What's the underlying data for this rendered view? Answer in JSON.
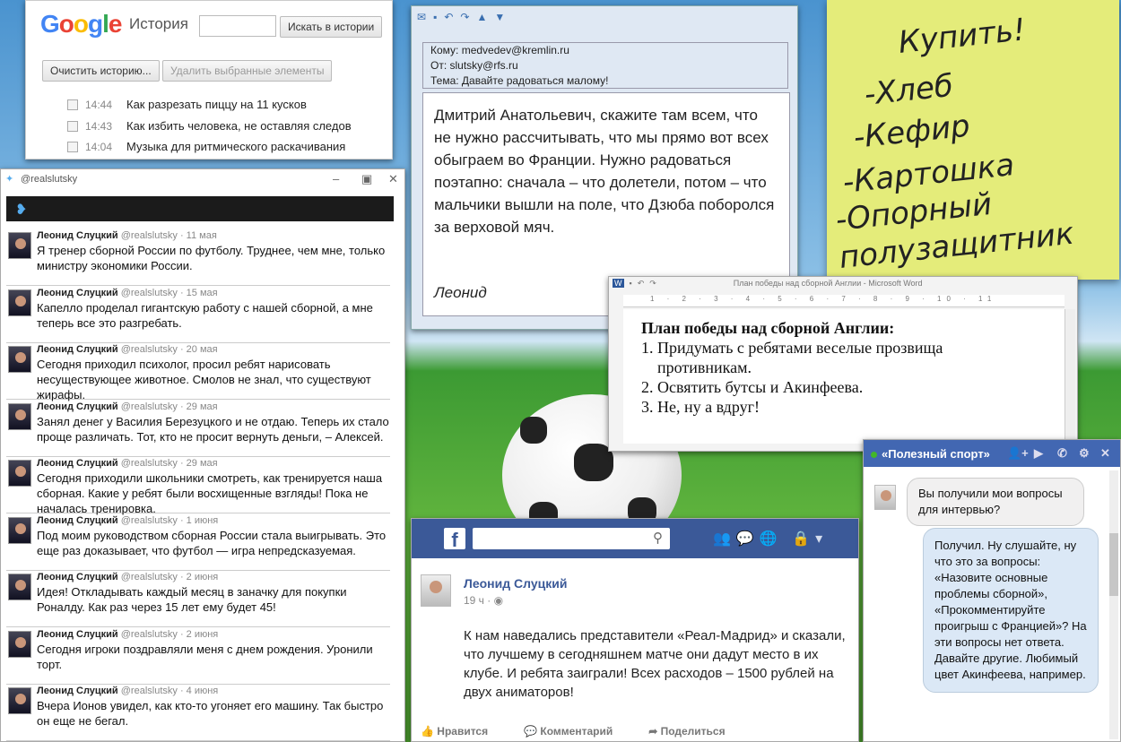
{
  "colors": {
    "google_blue": "#4285f4",
    "google_red": "#ea4335",
    "google_yellow": "#fbbc05",
    "google_green": "#34a853",
    "facebook_blue": "#3b5998",
    "messenger_blue": "#4267b2",
    "sticky_yellow": "#e4ec7a",
    "twitter_blue": "#55acee"
  },
  "google": {
    "logo": "Google",
    "title": "История",
    "search_button": "Искать в истории",
    "clear_button": "Очистить историю...",
    "delete_button": "Удалить выбранные элементы",
    "items": [
      {
        "time": "14:44",
        "text": "Как разрезать пиццу на 11 кусков"
      },
      {
        "time": "14:43",
        "text": "Как избить человека, не оставляя следов"
      },
      {
        "time": "14:04",
        "text": "Музыка для ритмического раскачивания"
      }
    ]
  },
  "twitter": {
    "window_title": "@realslutsky",
    "tweets": [
      {
        "name": "Леонид Слуцкий",
        "handle": "@realslutsky · 11 мая",
        "text": "Я тренер сборной России по футболу. Труднее, чем мне, только министру экономики России."
      },
      {
        "name": "Леонид Слуцкий",
        "handle": "@realslutsky · 15 мая",
        "text": "Капелло проделал гигантскую работу с нашей сборной, а мне теперь все это разгребать."
      },
      {
        "name": "Леонид Слуцкий",
        "handle": "@realslutsky · 20 мая",
        "text": "Сегодня приходил психолог, просил ребят нарисовать несуществующее животное. Смолов не знал, что существуют жирафы."
      },
      {
        "name": "Леонид Слуцкий",
        "handle": "@realslutsky · 29 мая",
        "text": "Занял денег у Василия Березуцкого и не отдаю. Теперь их стало проще различать. Тот, кто не просит вернуть деньги, – Алексей."
      },
      {
        "name": "Леонид Слуцкий",
        "handle": "@realslutsky · 29 мая",
        "text": "Сегодня приходили школьники смотреть, как тренируется наша сборная. Какие у ребят были восхищенные взгляды! Пока не началась тренировка."
      },
      {
        "name": "Леонид Слуцкий",
        "handle": "@realslutsky · 1 июня",
        "text": "Под моим руководством сборная России стала выигрывать. Это еще раз доказывает, что футбол — игра непредсказуемая."
      },
      {
        "name": "Леонид Слуцкий",
        "handle": "@realslutsky · 2 июня",
        "text": "Идея! Откладывать каждый месяц в заначку для покупки Роналду. Как раз через 15 лет ему будет 45!"
      },
      {
        "name": "Леонид Слуцкий",
        "handle": "@realslutsky · 2 июня",
        "text": "Сегодня игроки поздравляли меня с днем рождения. Уронили торт."
      },
      {
        "name": "Леонид Слуцкий",
        "handle": "@realslutsky · 4 июня",
        "text": "Вчера Ионов увидел, как кто-то угоняет его машину. Так быстро он еще не бегал."
      }
    ]
  },
  "email": {
    "to": "Кому: medvedev@kremlin.ru",
    "from": "От: slutsky@rfs.ru",
    "subject": "Тема: Давайте радоваться малому!",
    "body": "Дмитрий Анатольевич, скажите там всем, что не нужно рассчитывать, что мы прямо вот всех обыграем во Франции. Нужно радоваться поэтапно: сначала – что долетели, потом – что мальчики вышли на поле, что Дзюба поборолся за верховой мяч.",
    "signature": "Леонид"
  },
  "sticky": {
    "lines": [
      "Купить!",
      "-Хлеб",
      "-Кефир",
      "-Картошка",
      "-Опорный",
      "полузащитник"
    ]
  },
  "word": {
    "title": "План победы над сборной Англии - Microsoft Word",
    "heading": "План победы над сборной Англии:",
    "items": [
      "1. Придумать с ребятами веселые прозвища",
      "противникам.",
      "2. Освятить бутсы и Акинфеева.",
      "3. Не, ну а вдруг!"
    ]
  },
  "facebook": {
    "name": "Леонид Слуцкий",
    "time": "19 ч · ◉",
    "text": "К нам наведались представители «Реал-Мадрид» и сказали, что лучшему в сегодняшнем матче они дадут место в их клубе. И ребята заиграли! Всех расходов – 1500 рублей на двух аниматоров!",
    "like": "Нравится",
    "comment": "Комментарий",
    "share": "Поделиться"
  },
  "chat": {
    "title": "«Полезный спорт»",
    "incoming": "Вы получили мои вопросы для интервью?",
    "outgoing": "Получил. Ну слушайте, ну что это за вопросы: «Назовите основные проблемы сборной», «Прокомментируйте проигрыш с Францией»? На эти вопросы нет ответа. Давайте другие. Любимый цвет Акинфеева, например."
  }
}
